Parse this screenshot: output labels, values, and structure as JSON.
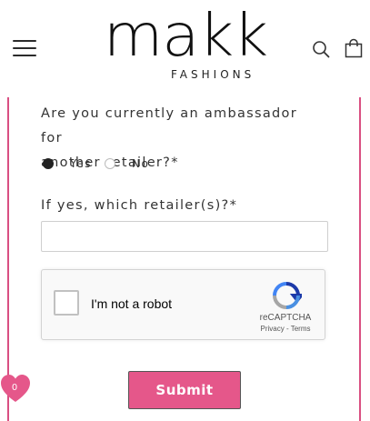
{
  "header": {
    "logo_main": "makk",
    "logo_sub": "FASHIONS"
  },
  "form": {
    "ambassador_question_line1": "Are you currently an ambassador for",
    "ambassador_question_line2": "another retailer?",
    "required_mark": "*",
    "options": [
      {
        "label": "Yes",
        "checked": true
      },
      {
        "label": "No",
        "checked": false
      }
    ],
    "retailer_question": "If yes, which retailer(s)?",
    "retailer_value": "",
    "submit_label": "Submit"
  },
  "captcha": {
    "label": "I'm not a robot",
    "brand": "reCAPTCHA",
    "privacy": "Privacy",
    "separator": " - ",
    "terms": "Terms"
  },
  "wishlist": {
    "count": "0"
  },
  "colors": {
    "accent_pink": "#e5578a",
    "frame_pink": "#d94f82"
  }
}
